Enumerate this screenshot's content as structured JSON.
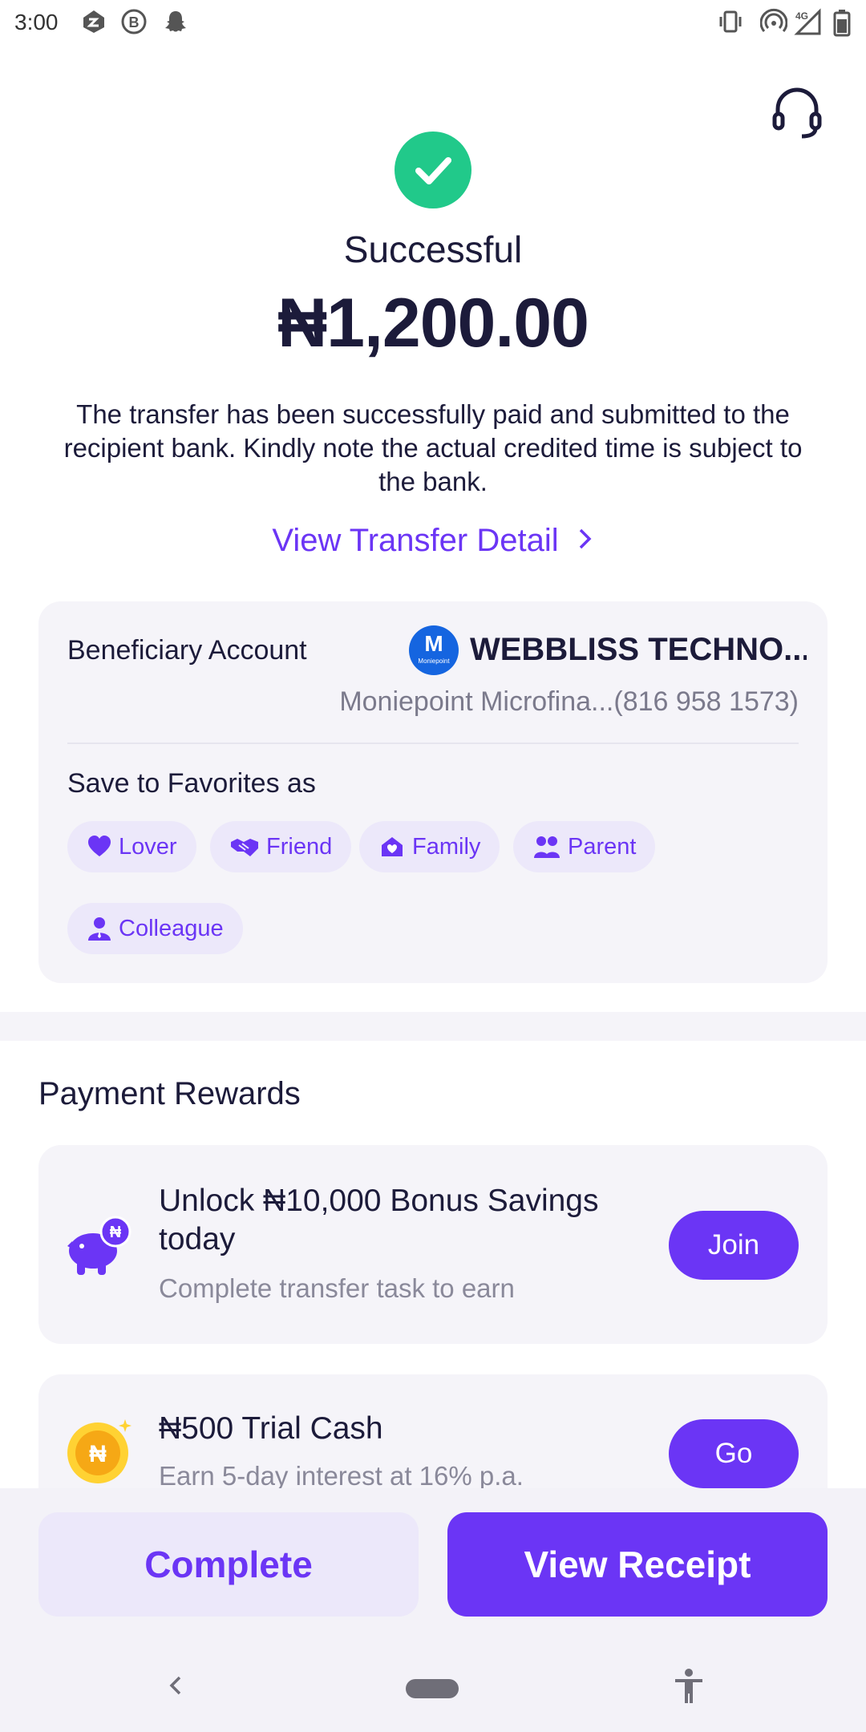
{
  "status_bar": {
    "time": "3:00",
    "left_icons": [
      "app-icon",
      "b-circle-icon",
      "snapchat-icon"
    ],
    "right_icons": [
      "vibrate-icon",
      "hotspot-icon",
      "signal-4g-icon",
      "battery-icon"
    ]
  },
  "header": {
    "support_icon": "headset-icon"
  },
  "result": {
    "status": "Successful",
    "amount": "₦1,200.00",
    "description": "The transfer has been successfully paid and submitted to the recipient bank. Kindly note the actual credited time is subject to the bank.",
    "detail_link": "View Transfer Detail",
    "colors": {
      "success": "#21c98a",
      "accent": "#6b35f5"
    }
  },
  "beneficiary": {
    "label": "Beneficiary Account",
    "logo_letter": "M",
    "logo_caption": "Moniepoint",
    "name": "WEBBLISS TECHNO...",
    "bank": "Moniepoint Microfina...(816 958 1573)",
    "favorites_label": "Save to Favorites as",
    "favorites": [
      {
        "label": "Lover",
        "icon": "heart-icon"
      },
      {
        "label": "Friend",
        "icon": "handshake-icon"
      },
      {
        "label": "Family",
        "icon": "home-heart-icon"
      },
      {
        "label": "Parent",
        "icon": "people-icon"
      },
      {
        "label": "Colleague",
        "icon": "person-icon"
      }
    ]
  },
  "rewards": {
    "title": "Payment Rewards",
    "items": [
      {
        "title": "Unlock ₦10,000 Bonus Savings today",
        "subtitle": "Complete transfer task to earn",
        "button": "Join",
        "icon": "piggy-bank-icon"
      },
      {
        "title": "₦500 Trial Cash",
        "subtitle": "Earn 5-day interest at 16% p.a.",
        "button": "Go",
        "icon": "coin-icon",
        "coin_symbol": "₦"
      }
    ]
  },
  "actions": {
    "complete": "Complete",
    "view_receipt": "View Receipt"
  },
  "nav": {
    "icons": [
      "back-icon",
      "home-pill",
      "accessibility-icon"
    ]
  }
}
